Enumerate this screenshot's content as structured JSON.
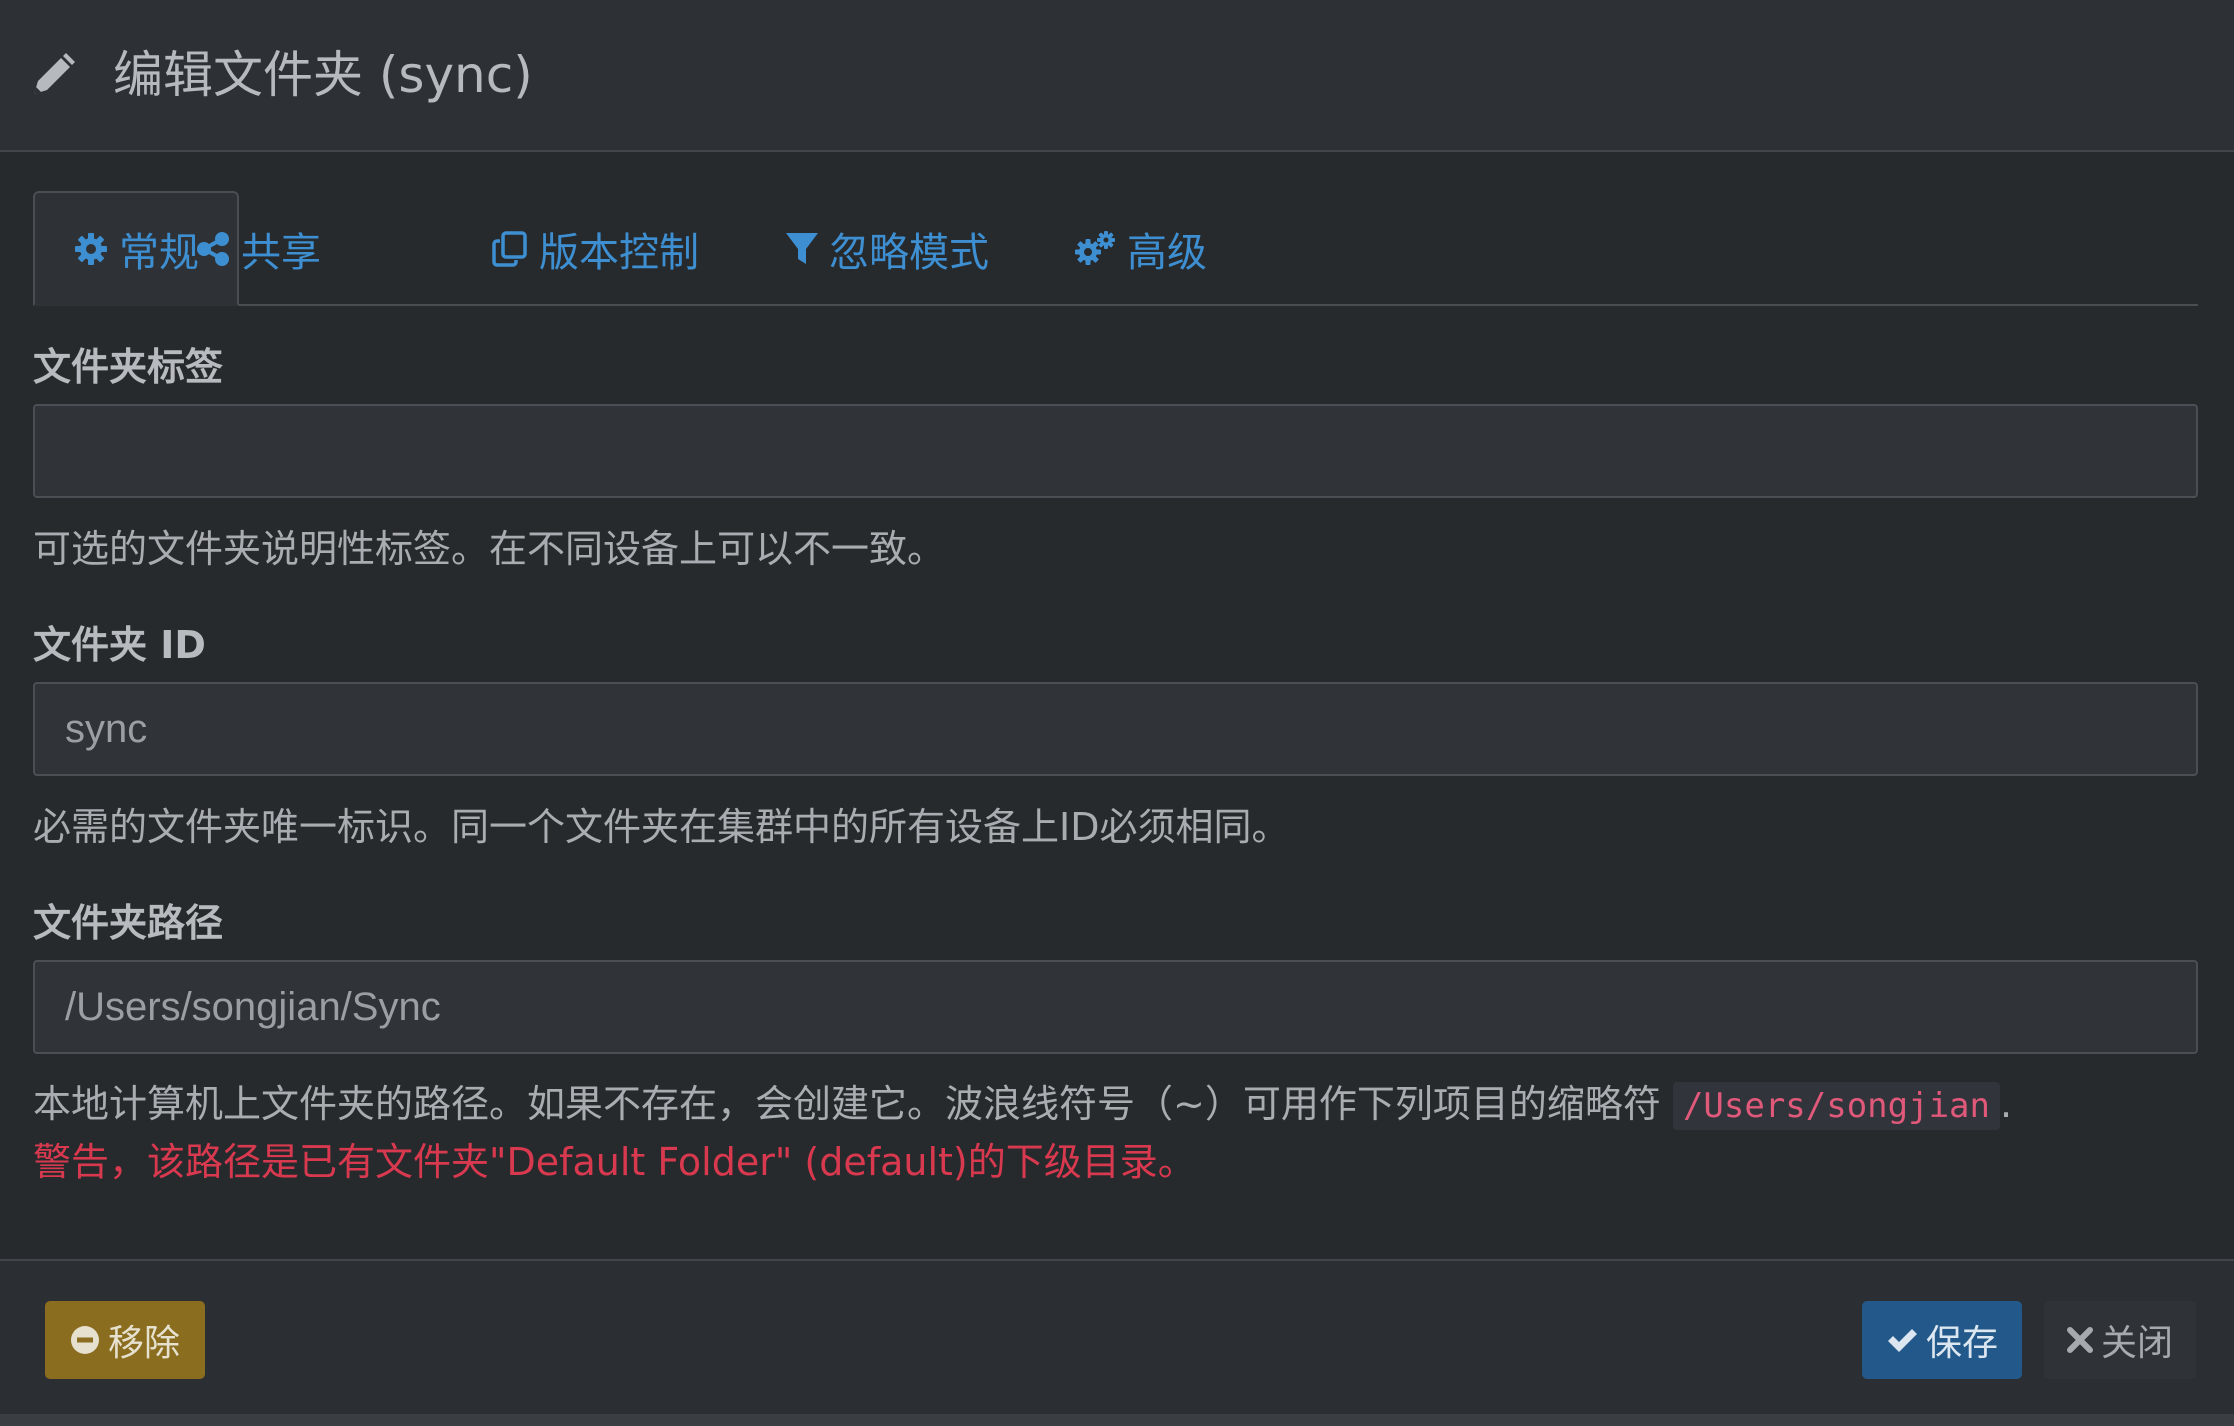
{
  "header": {
    "title": "编辑文件夹 (sync)",
    "icon": "pencil-icon"
  },
  "tabs": [
    {
      "label": "常规",
      "icon": "gear-icon",
      "active": true
    },
    {
      "label": "共享",
      "icon": "share-icon",
      "active": false
    },
    {
      "label": "版本控制",
      "icon": "copy-icon",
      "active": false
    },
    {
      "label": "忽略模式",
      "icon": "filter-icon",
      "active": false
    },
    {
      "label": "高级",
      "icon": "gears-icon",
      "active": false
    }
  ],
  "form": {
    "folder_label": {
      "label": "文件夹标签",
      "value": "",
      "help": "可选的文件夹说明性标签。在不同设备上可以不一致。"
    },
    "folder_id": {
      "label": "文件夹 ID",
      "value": "sync",
      "help": "必需的文件夹唯一标识。同一个文件夹在集群中的所有设备上ID必须相同。"
    },
    "folder_path": {
      "label": "文件夹路径",
      "value": "/Users/songjian/Sync",
      "help_prefix": "本地计算机上文件夹的路径。如果不存在，会创建它。波浪线符号（~）可用作下列项目的缩略符",
      "help_code": "/Users/songjian",
      "help_suffix": ".",
      "warning": "警告，该路径是已有文件夹\"Default Folder\" (default)的下级目录。"
    }
  },
  "footer": {
    "remove_label": "移除",
    "save_label": "保存",
    "close_label": "关闭"
  },
  "colors": {
    "accent": "#3d8fd1",
    "warning": "#d9394f",
    "remove_button": "#8a6d1e",
    "save_button": "#23598a"
  }
}
